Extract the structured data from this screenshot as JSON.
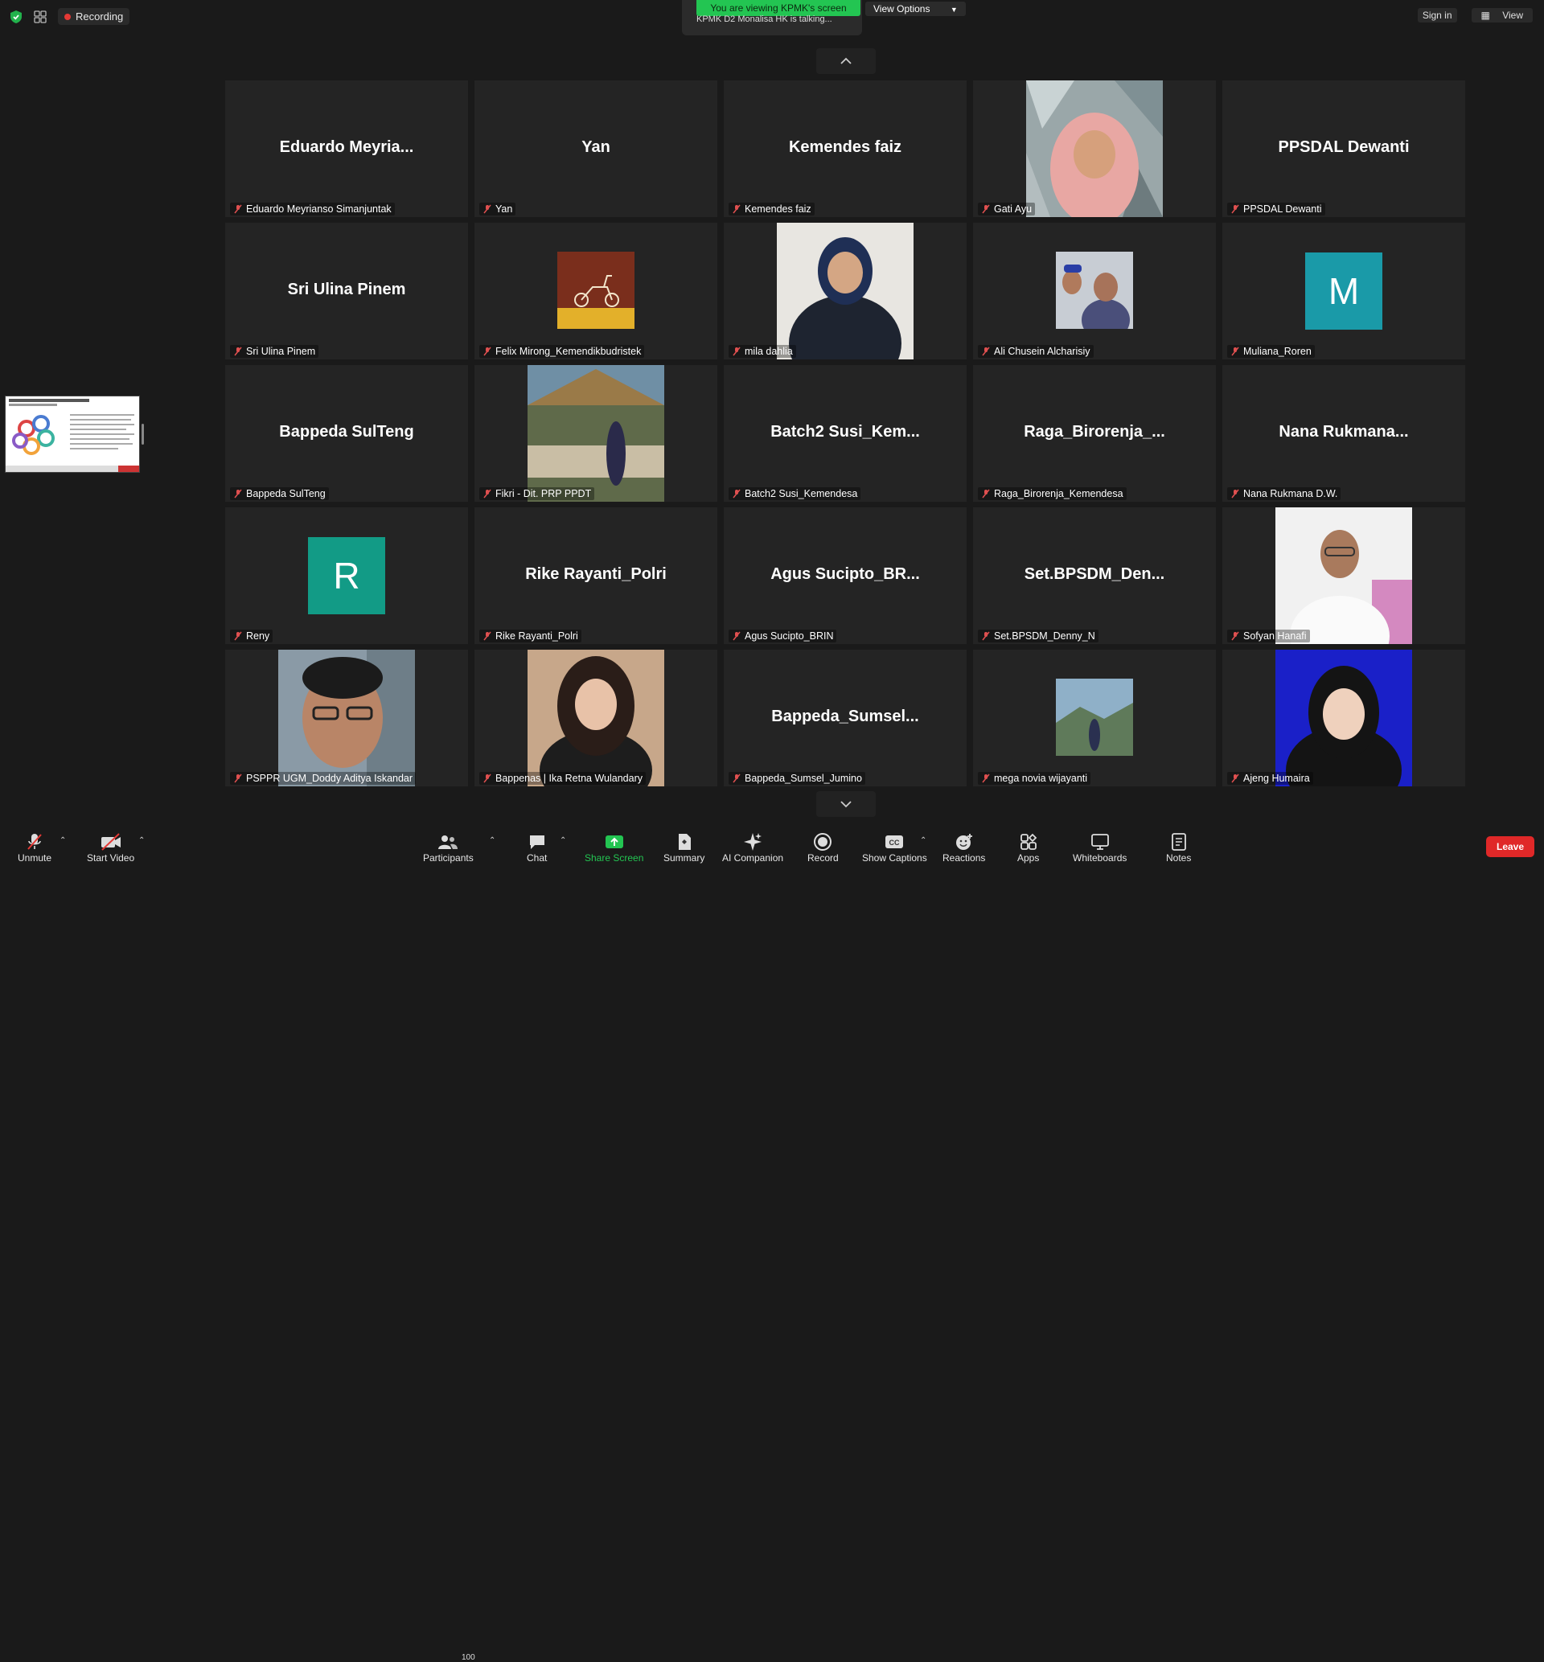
{
  "topbar": {
    "recording_label": "Recording",
    "viewing_banner": "You are viewing KPMK's screen",
    "talking_text": "KPMK D2 Monalisa HK is talking...",
    "view_options": "View Options",
    "sign_in": "Sign in",
    "view": "View"
  },
  "tiles": [
    {
      "display": "Eduardo Meyria...",
      "name": "Eduardo Meyrianso Simanjuntak"
    },
    {
      "display": "Yan",
      "name": "Yan"
    },
    {
      "display": "Kemendes faiz",
      "name": "Kemendes faiz"
    },
    {
      "display": "",
      "name": "Gati Ayu"
    },
    {
      "display": "PPSDAL Dewanti",
      "name": "PPSDAL Dewanti"
    },
    {
      "display": "Sri Ulina Pinem",
      "name": "Sri Ulina Pinem"
    },
    {
      "display": "",
      "name": "Felix Mirong_Kemendikbudristek"
    },
    {
      "display": "",
      "name": "mila dahlia"
    },
    {
      "display": "",
      "name": "Ali Chusein Alcharisiy"
    },
    {
      "display": "M",
      "name": "Muliana_Roren"
    },
    {
      "display": "Bappeda SulTeng",
      "name": "Bappeda SulTeng"
    },
    {
      "display": "",
      "name": "Fikri - Dit. PRP PPDT"
    },
    {
      "display": "Batch2 Susi_Kem...",
      "name": "Batch2 Susi_Kemendesa"
    },
    {
      "display": "Raga_Birorenja_...",
      "name": "Raga_Birorenja_Kemendesa"
    },
    {
      "display": "Nana Rukmana...",
      "name": "Nana Rukmana D.W."
    },
    {
      "display": "R",
      "name": "Reny"
    },
    {
      "display": "Rike Rayanti_Polri",
      "name": "Rike Rayanti_Polri"
    },
    {
      "display": "Agus Sucipto_BR...",
      "name": "Agus Sucipto_BRIN"
    },
    {
      "display": "Set.BPSDM_Den...",
      "name": "Set.BPSDM_Denny_N"
    },
    {
      "display": "",
      "name": "Sofyan Hanafi"
    },
    {
      "display": "",
      "name": "PSPPR UGM_Doddy Aditya Iskandar"
    },
    {
      "display": "",
      "name": "Bappenas | Ika Retna Wulandary"
    },
    {
      "display": "Bappeda_Sumsel...",
      "name": "Bappeda_Sumsel_Jumino"
    },
    {
      "display": "",
      "name": "mega novia wijayanti"
    },
    {
      "display": "",
      "name": "Ajeng Humaira"
    }
  ],
  "toolbar": {
    "unmute": "Unmute",
    "start_video": "Start Video",
    "participants": "Participants",
    "participants_count": "100",
    "chat": "Chat",
    "share_screen": "Share Screen",
    "summary": "Summary",
    "ai_companion": "AI Companion",
    "record": "Record",
    "show_captions": "Show Captions",
    "reactions": "Reactions",
    "apps": "Apps",
    "whiteboards": "Whiteboards",
    "notes": "Notes",
    "leave": "Leave"
  },
  "colors": {
    "banner_green": "#23c552",
    "share_green": "#23c552",
    "leave_red": "#e02828",
    "avatar_teal_m": "#1a9aa8",
    "avatar_teal_r": "#129b86",
    "muted_red": "#e05050"
  }
}
